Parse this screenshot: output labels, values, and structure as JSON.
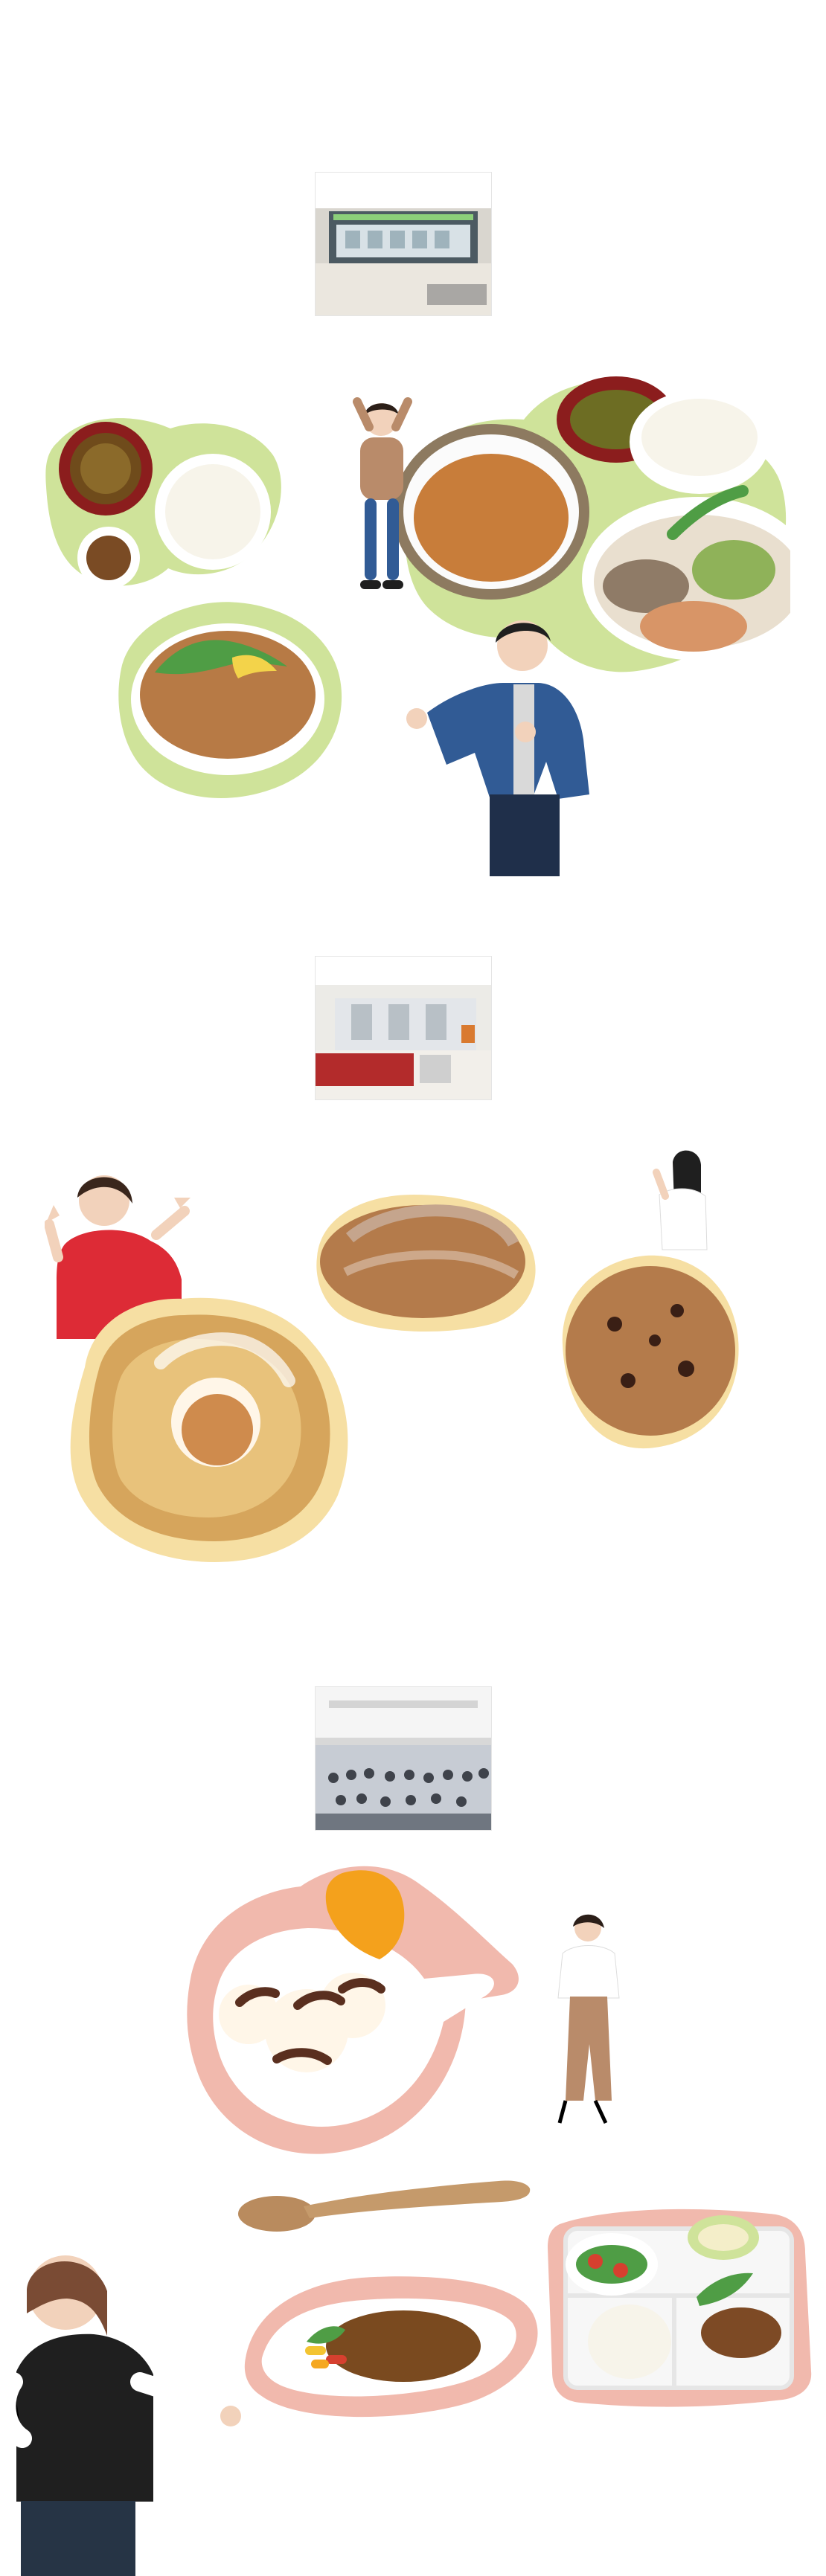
{
  "sections": [
    {
      "photo_icon": "cafeteria-counter-photo",
      "items": [
        "set-meal-1",
        "set-meal-2",
        "pork-rice-bowl",
        "person-1",
        "person-2"
      ]
    },
    {
      "photo_icon": "bakery-interior-photo",
      "items": [
        "danish-pastry",
        "almond-bread",
        "raisin-bread",
        "person-3",
        "person-4"
      ]
    },
    {
      "photo_icon": "dining-hall-photo",
      "items": [
        "soft-serve-parfait",
        "curry-plate",
        "lunch-tray",
        "person-5",
        "person-6"
      ]
    }
  ],
  "colors": {
    "green_outline": "#cfe39a",
    "cream_outline": "#f6dfa3",
    "pink_outline": "#f1b9ad",
    "rice": "#f7f4ea",
    "miso": "#7a4b24",
    "soup_bowl": "#8b1d1d",
    "meat": "#b77a45",
    "bread": "#b47b4b",
    "pastry": "#d6a55c",
    "cream": "#fff6e8",
    "orange": "#f4a11c",
    "curry": "#7a4a1f",
    "salad": "#4f9d45",
    "tray": "#f7f7f7",
    "chocolate": "#5a2f1f",
    "clothing_red": "#dd2b36",
    "clothing_blue": "#315b95",
    "clothing_black": "#1f1f1f",
    "clothing_beige": "#b98b6a"
  }
}
